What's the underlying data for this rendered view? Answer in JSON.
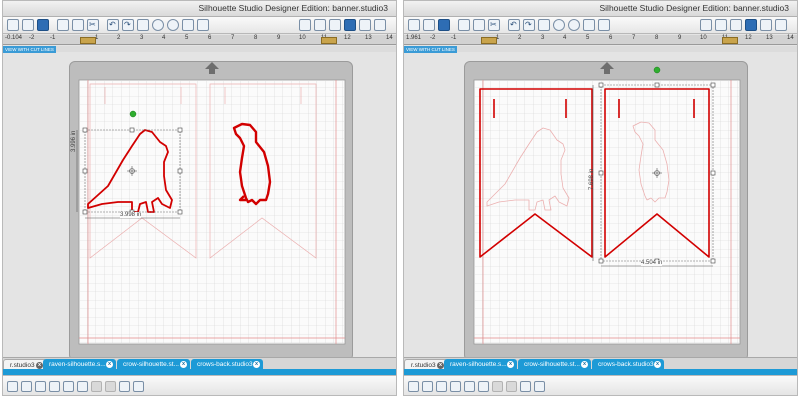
{
  "panels": [
    {
      "window_title": "Silhouette Studio Designer Edition: banner.studio3",
      "cut_lines_label": "VIEW WITH CUT LINES",
      "ruler_numbers": [
        "-0.104",
        "-2",
        "-1",
        "1",
        "2",
        "3",
        "4",
        "5",
        "6",
        "7",
        "8",
        "9",
        "10",
        "11",
        "12",
        "13",
        "14"
      ],
      "height_readout": "3.996 in",
      "width_readout": "3.998 in",
      "tabs": [
        {
          "label": "r.studio3"
        },
        {
          "label": "raven-silhouette.s..."
        },
        {
          "label": "crow-silhouette.st..."
        },
        {
          "label": "crows-back.studio3"
        }
      ]
    },
    {
      "window_title": "Silhouette Studio Designer Edition: banner.studio3",
      "cut_lines_label": "VIEW WITH CUT LINES",
      "ruler_numbers": [
        "1.961",
        "-2",
        "-1",
        "1",
        "2",
        "3",
        "4",
        "5",
        "6",
        "7",
        "8",
        "9",
        "10",
        "11",
        "12",
        "13",
        "14"
      ],
      "height_readout": "7.698 in",
      "width_readout": "4.504 in",
      "tabs": [
        {
          "label": "r.studio3"
        },
        {
          "label": "raven-silhouette.s..."
        },
        {
          "label": "crow-silhouette.st..."
        },
        {
          "label": "crows-back.studio3"
        }
      ]
    }
  ],
  "colors": {
    "cut_line": "#d20000",
    "guide_line": "#e8a0a0",
    "tab_blue": "#1d9ad6",
    "selection_handle_green": "#2fae2f"
  },
  "icons": {
    "toolbar": [
      "new-document-icon",
      "open-icon",
      "save-icon",
      "print-icon",
      "cut-icon",
      "copy-icon",
      "paste-icon",
      "undo-icon",
      "redo-icon",
      "pan-icon",
      "zoom-in-icon",
      "zoom-out-icon",
      "zoom-select-icon",
      "fit-page-icon"
    ],
    "bottom": [
      "group-icon",
      "ungroup-icon",
      "duplicate-icon",
      "delete-icon",
      "weld-icon",
      "offset-icon",
      "trace-icon",
      "fill-icon",
      "line-color-icon",
      "cut-settings-icon"
    ]
  }
}
